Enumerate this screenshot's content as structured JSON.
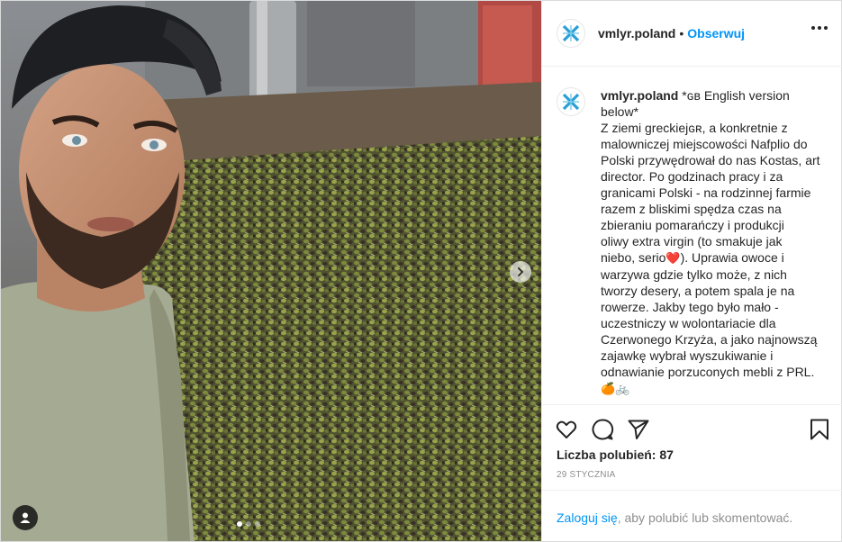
{
  "header": {
    "username": "vmlyr.poland",
    "separator": "•",
    "follow_label": "Obserwuj"
  },
  "caption": {
    "username": "vmlyr.poland",
    "text_lines": [
      "*ɢʙ English version",
      "below*",
      "Z ziemi greckiejɢʀ, a konkretnie z",
      "malowniczej miejscowości Nafplio do",
      "Polski przywędrował do nas Kostas, art",
      "director. Po godzinach pracy i za",
      "granicami Polski - na rodzinnej farmie",
      "razem z bliskimi spędza czas na",
      "zbieraniu pomarańczy i produkcji",
      "oliwy extra virgin (to smakuje jak",
      "niebo, serio",
      "). Uprawia owoce i",
      "warzywa gdzie tylko może, z nich",
      "tworzy desery, a potem spala je na",
      "rowerze. Jakby tego było mało -",
      "uczestniczy w wolontariacie dla",
      "Czerwonego Krzyża, a jako najnowszą",
      "zajawkę wybrał wyszukiwanie i",
      "odnawianie porzuconych mebli z PRL."
    ],
    "emojis": [
      "❤️",
      "🍊",
      "🚲"
    ]
  },
  "actions": {
    "like_icon": "heart-icon",
    "comment_icon": "comment-icon",
    "share_icon": "paper-plane-icon",
    "save_icon": "bookmark-icon"
  },
  "likes_text": "Liczba polubień: 87",
  "date_text": "29 STYCZNIA",
  "login": {
    "link_label": "Zaloguj się",
    "rest_text": ", aby polubić lub skomentować."
  },
  "colors": {
    "accent": "#0095f6",
    "text": "#262626",
    "muted": "#8e8e8e",
    "heart": "#e0245e",
    "brand": "#2a9fd6"
  }
}
